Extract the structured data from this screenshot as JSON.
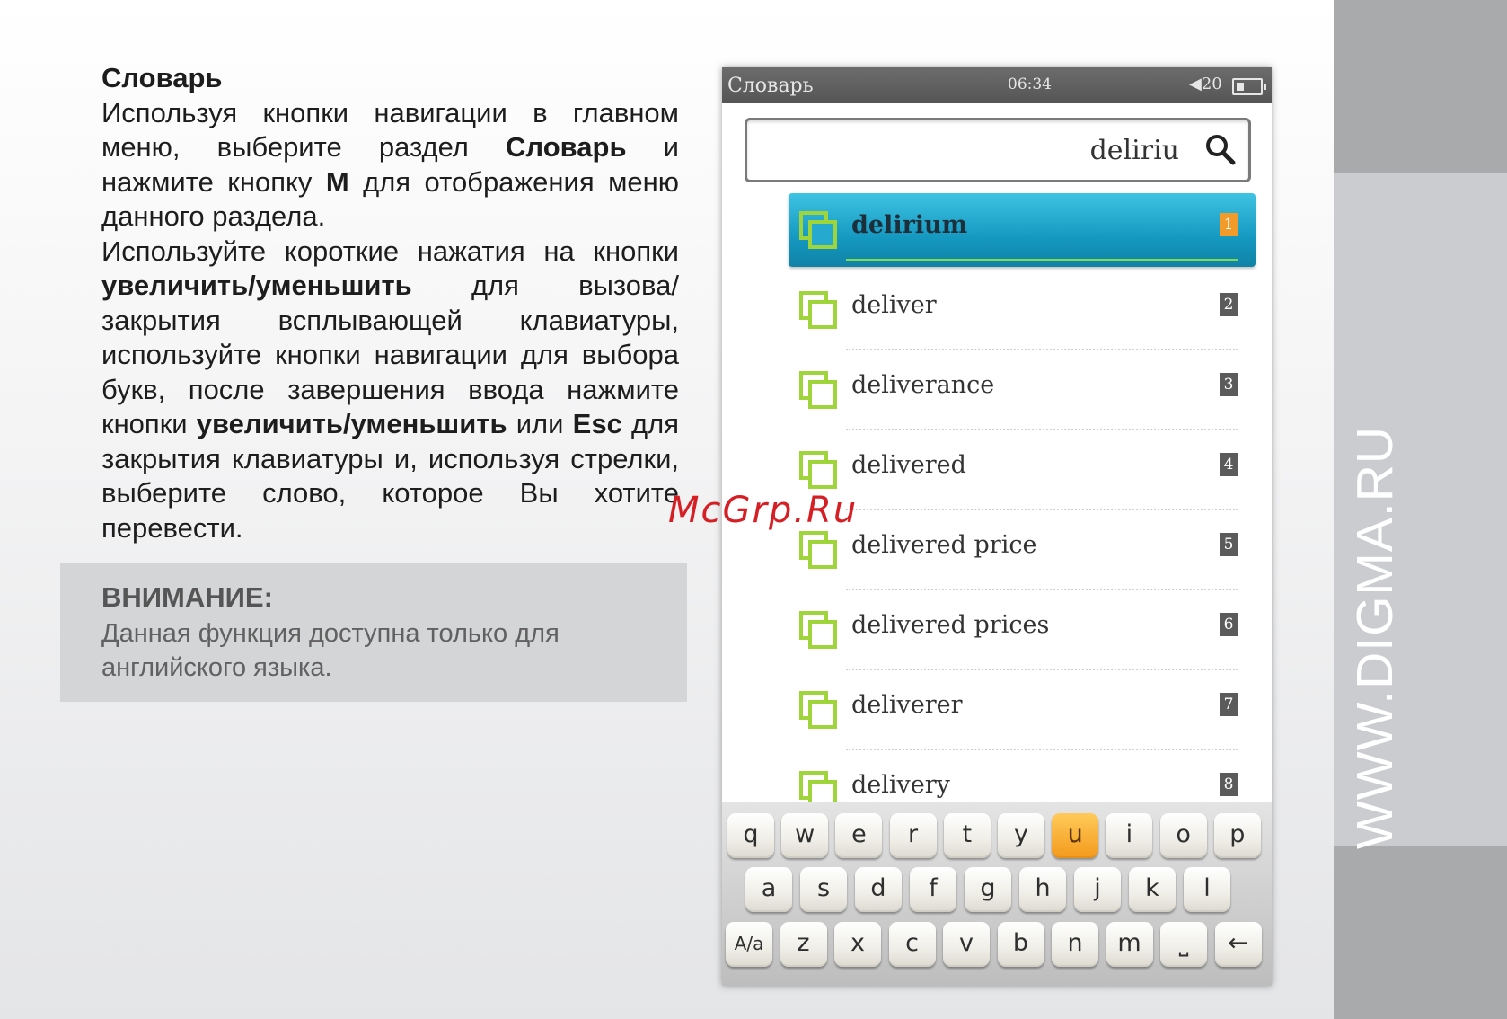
{
  "heading": "Словарь",
  "para1": {
    "t1": "Используя кнопки навигации в главном меню, выберите раздел ",
    "b1": "Словарь",
    "t2": " и нажмите кнопку ",
    "b2": "M",
    "t3": " для отображения меню данного раздела."
  },
  "para2": {
    "t1": "Используйте короткие нажатия на кнопки ",
    "b1": "увеличить/уменьшить",
    "t2": " для вызова/ закрытия всплывающей клавиатуры, используйте кнопки навигации для выбора букв, после завершения ввода нажмите кнопки ",
    "b2": "увеличить/уменьшить",
    "t3": " или ",
    "b3": "Esc",
    "t4": " для закрытия клавиатуры и, используя стрелки, выберите слово, которое Вы хотите перевести."
  },
  "note": {
    "title": "ВНИМАНИЕ:",
    "text": "Данная функция доступна только для английского языка."
  },
  "watermark": "McGrp.Ru",
  "side_label": "WWW.DIGMA.RU",
  "device": {
    "status": {
      "app": "Словарь",
      "time": "06:34",
      "volume": "20"
    },
    "search": {
      "value": "deliriu"
    },
    "results": [
      {
        "word": "delirium",
        "num": "1",
        "selected": true
      },
      {
        "word": "deliver",
        "num": "2"
      },
      {
        "word": "deliverance",
        "num": "3"
      },
      {
        "word": "delivered",
        "num": "4"
      },
      {
        "word": "delivered price",
        "num": "5"
      },
      {
        "word": "delivered prices",
        "num": "6"
      },
      {
        "word": "deliverer",
        "num": "7"
      },
      {
        "word": "delivery",
        "num": "8"
      }
    ],
    "keyboard": {
      "row1": [
        "q",
        "w",
        "e",
        "r",
        "t",
        "y",
        "u",
        "i",
        "o",
        "p"
      ],
      "row2": [
        "a",
        "s",
        "d",
        "f",
        "g",
        "h",
        "j",
        "k",
        "l"
      ],
      "row3": [
        "A/a",
        "z",
        "x",
        "c",
        "v",
        "b",
        "n",
        "m",
        "⎵",
        "←"
      ],
      "active": "u"
    }
  }
}
